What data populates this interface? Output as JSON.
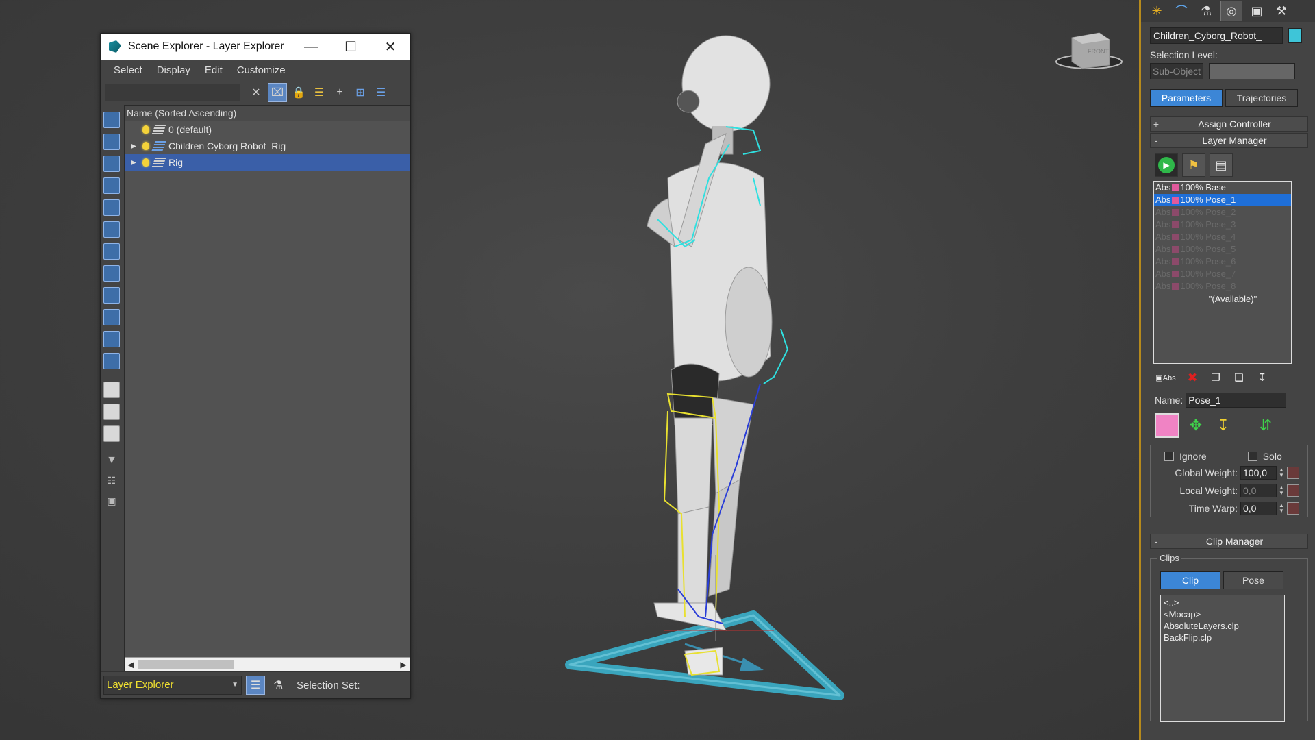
{
  "scene_explorer": {
    "title": "Scene Explorer - Layer Explorer",
    "menu": [
      "Select",
      "Display",
      "Edit",
      "Customize"
    ],
    "search_placeholder": "",
    "tree_header": "Name (Sorted Ascending)",
    "rows": [
      {
        "label": "0 (default)",
        "expandable": false,
        "selected": false
      },
      {
        "label": "Children Cyborg Robot_Rig",
        "expandable": true,
        "selected": false
      },
      {
        "label": "Rig",
        "expandable": true,
        "selected": true
      }
    ],
    "explorer_mode": "Layer Explorer",
    "selection_set_label": "Selection Set:"
  },
  "command_panel": {
    "object_name": "Children_Cyborg_Robot_",
    "object_color": "#3ec5d8",
    "selection_level_label": "Selection Level:",
    "sub_object": "Sub-Object",
    "tab_parameters": "Parameters",
    "tab_trajectories": "Trajectories",
    "rollout_assign": "Assign Controller",
    "rollout_layer_manager": "Layer Manager",
    "layers": [
      {
        "text": "Abs",
        "pct": "100%",
        "name": "Base",
        "state": "normal"
      },
      {
        "text": "Abs",
        "pct": "100%",
        "name": "Pose_1",
        "state": "selected"
      },
      {
        "text": "Abs",
        "pct": "100%",
        "name": "Pose_2",
        "state": "dim"
      },
      {
        "text": "Abs",
        "pct": "100%",
        "name": "Pose_3",
        "state": "dim"
      },
      {
        "text": "Abs",
        "pct": "100%",
        "name": "Pose_4",
        "state": "dim"
      },
      {
        "text": "Abs",
        "pct": "100%",
        "name": "Pose_5",
        "state": "dim"
      },
      {
        "text": "Abs",
        "pct": "100%",
        "name": "Pose_6",
        "state": "dim"
      },
      {
        "text": "Abs",
        "pct": "100%",
        "name": "Pose_7",
        "state": "dim"
      },
      {
        "text": "Abs",
        "pct": "100%",
        "name": "Pose_8",
        "state": "dim"
      }
    ],
    "available_label": "\"(Available)\"",
    "name_label": "Name:",
    "name_value": "Pose_1",
    "layer_color": "#f083c4",
    "ignore_label": "Ignore",
    "solo_label": "Solo",
    "global_weight_label": "Global Weight:",
    "global_weight_value": "100,0",
    "local_weight_label": "Local Weight:",
    "local_weight_value": "0,0",
    "time_warp_label": "Time Warp:",
    "time_warp_value": "0,0",
    "rollout_clip_manager": "Clip Manager",
    "clips_label": "Clips",
    "clip_tab": "Clip",
    "pose_tab": "Pose",
    "clips": [
      "<..>",
      "<Mocap>",
      "AbsoluteLayers.clp",
      "BackFlip.clp"
    ]
  },
  "viewcube_face": "FRONT"
}
